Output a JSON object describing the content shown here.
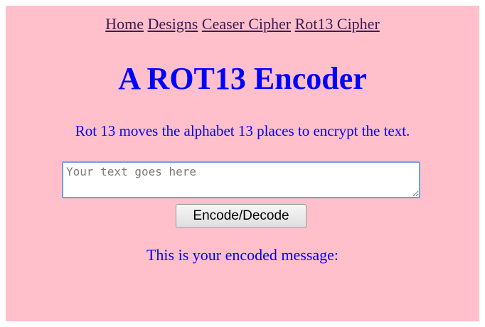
{
  "nav": {
    "links": [
      "Home",
      "Designs",
      "Ceaser Cipher",
      "Rot13 Cipher"
    ]
  },
  "page": {
    "title": "A ROT13 Encoder",
    "description": "Rot 13 moves the alphabet 13 places to encrypt the text.",
    "result_label": "This is your encoded message:"
  },
  "form": {
    "input_placeholder": "Your text goes here",
    "input_value": "",
    "button_label": "Encode/Decode"
  },
  "colors": {
    "background": "#ffc0cb",
    "heading": "#0000ff",
    "link": "#3c1a56"
  }
}
